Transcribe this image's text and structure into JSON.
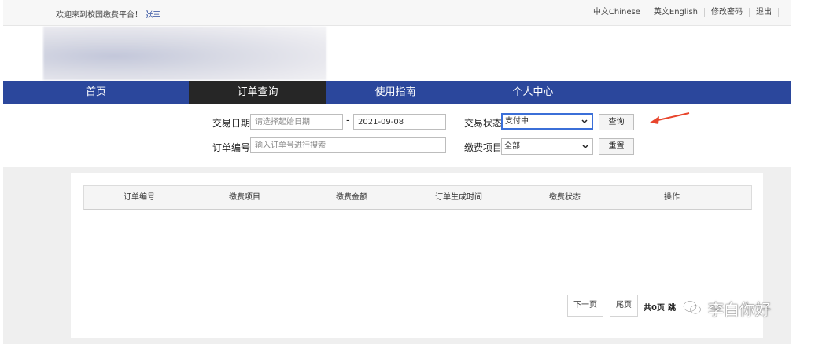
{
  "topbar": {
    "welcome": "欢迎来到校园缴费平台！",
    "username": "张三",
    "links": [
      "中文Chinese",
      "英文English",
      "修改密码",
      "退出"
    ]
  },
  "nav": {
    "items": [
      "首页",
      "订单查询",
      "使用指南",
      "个人中心"
    ],
    "active_index": 1
  },
  "search": {
    "date_label": "交易日期",
    "start_date_placeholder": "请选择起始日期",
    "date_separator": "-",
    "end_date_value": "2021-09-08",
    "status_label": "交易状态",
    "status_selected": "支付中",
    "query_button": "查询",
    "order_no_label": "订单编号",
    "order_no_placeholder": "输入订单号进行搜索",
    "item_label": "缴费项目",
    "item_selected": "全部",
    "reset_button": "重置"
  },
  "table": {
    "columns": [
      "订单编号",
      "缴费项目",
      "缴费金额",
      "订单生成时间",
      "缴费状态",
      "操作"
    ],
    "rows": []
  },
  "pager": {
    "next": "下一页",
    "last": "尾页",
    "total": "共0页",
    "jump": "跳"
  },
  "watermark": {
    "text": "李白你好",
    "icon": "wechat-icon"
  },
  "colors": {
    "nav_bg": "#2b479c",
    "nav_active_bg": "#262626",
    "arrow": "#e8452c",
    "username": "#2a4a9c"
  }
}
